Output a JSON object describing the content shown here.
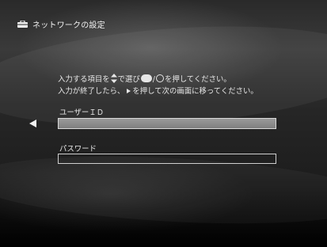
{
  "header": {
    "title": "ネットワークの設定",
    "icon": "toolbox-icon"
  },
  "instructions": {
    "line1_part1": "入力する項目を",
    "line1_part2": "で選び",
    "line1_part3": "/",
    "line1_part4": "を押してください。",
    "line2_part1": "入力が終了したら、",
    "line2_part2": "を押して次の画面に移ってください。",
    "icons": [
      "updown-arrows-icon",
      "enter-button-icon",
      "circle-button-icon",
      "right-arrow-icon"
    ]
  },
  "form": {
    "user_id": {
      "label": "ユーザーＩＤ",
      "value": ""
    },
    "password": {
      "label": "パスワード",
      "value": ""
    },
    "focused_field": "user_id"
  },
  "colors": {
    "text": "#e6e6e6",
    "focused_field": "#8c8c8c",
    "field_border": "#cfcfcf"
  }
}
